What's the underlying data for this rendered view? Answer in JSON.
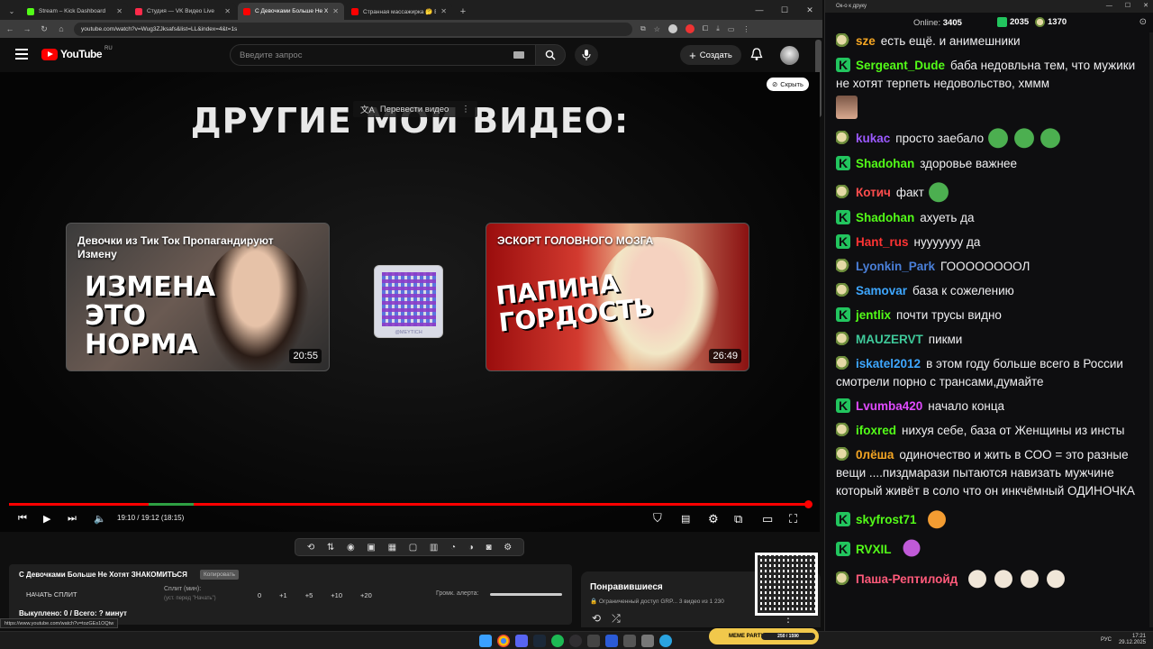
{
  "browser": {
    "tabs": [
      {
        "title": "Stream – Kick Dashboard",
        "fav": "#53fc18"
      },
      {
        "title": "Студия — VK Видео Live",
        "fav": "#ff2a4a"
      },
      {
        "title": "С Девочками Больше Не Хотя",
        "fav": "#ff0000",
        "active": true
      },
      {
        "title": "Странная массажирка 🤔 Вид",
        "fav": "#ff0000"
      }
    ],
    "url": "youtube.com/watch?v=Wug3ZJksafs&list=LL&index=4&t=1s",
    "status_url": "https://www.youtube.com/watch?v=tozGEs1OQtw"
  },
  "youtube": {
    "logo": "YouTube",
    "region": "RU",
    "search_placeholder": "Введите запрос",
    "create_label": "Создать"
  },
  "endscreen": {
    "heading": "ДРУГИЕ МОИ ВИДЕО:",
    "translate": "Перевести видео",
    "hide": "Скрыть",
    "cards": [
      {
        "title": "Девочки из Тик Ток Пропагандируют Измену",
        "thumb_text": "ИЗМЕНА ЭТО НОРМА",
        "duration": "20:55"
      },
      {
        "title": "ЭСКОРТ ГОЛОВНОГО МОЗГА",
        "thumb_text": "ПАПИНА ГОРДОСТЬ",
        "duration": "26:49"
      }
    ],
    "qr_label": "@MEYTICH"
  },
  "player": {
    "time": "19:10 / 19:12 (18:15)",
    "progress_fraction": 0.998
  },
  "panel": {
    "title": "С Девочками Больше Не Хотят ЗНАКОМИТЬСЯ",
    "badge": "Копировать",
    "start": "НАЧАТЬ СПЛИТ",
    "split_label": "Сплит (мин):",
    "split_hint": "(уст. перед \"Начать\")",
    "nums": [
      "0",
      "+1",
      "+5",
      "+10",
      "+20"
    ],
    "alert_label": "Громк. алерта:",
    "bought": "Выкуплено: 0 / Всего: ? минут"
  },
  "liked": {
    "title": "Понравившиеся",
    "sub": "🔒 Ограниченный доступ  GRP...  3 видео из 1 230"
  },
  "meme": {
    "label": "MEME PARTY",
    "progress": "250 / 1590"
  },
  "taskbar": {
    "lang": "РУС",
    "time": "17:21",
    "date": "29.12.2025"
  },
  "chat": {
    "window_title": "Ок-о к друку",
    "online_label": "Online:",
    "online": "3405",
    "kick_count": "2035",
    "rumble_count": "1370",
    "messages": [
      {
        "platform": "r",
        "nick": "sze",
        "color": "#f5a623",
        "text": "есть ещё. и анимешники"
      },
      {
        "platform": "k",
        "nick": "Sergeant_Dude",
        "color": "#53fc18",
        "text": "баба недовльна тем, что мужики не хотят терпеть недовольство, хммм"
      },
      {
        "platform": "r",
        "nick": "kukac",
        "color": "#9b59ff",
        "text": "просто заебало",
        "emotes": [
          "frog",
          "frog",
          "frog"
        ]
      },
      {
        "platform": "k",
        "nick": "Shadohan",
        "color": "#53fc18",
        "text": "здоровье важнее"
      },
      {
        "platform": "r",
        "nick": "Котич",
        "color": "#ff4d4d",
        "text": "факт",
        "emotes": [
          "frog"
        ]
      },
      {
        "platform": "k",
        "nick": "Shadohan",
        "color": "#53fc18",
        "text": "ахуеть да"
      },
      {
        "platform": "k",
        "nick": "Hant_rus",
        "color": "#ff3333",
        "text": "нууууууу да"
      },
      {
        "platform": "r",
        "nick": "Lyonkin_Park",
        "color": "#4a7fd8",
        "text": "ГООООООООЛ"
      },
      {
        "platform": "r",
        "nick": "Samovar",
        "color": "#3ea7ff",
        "text": "база к сожелению"
      },
      {
        "platform": "k",
        "nick": "jentlix",
        "color": "#53fc18",
        "text": "почти трусы видно"
      },
      {
        "platform": "r",
        "nick": "MAUZERVT",
        "color": "#3fc99a",
        "text": "пикми"
      },
      {
        "platform": "r",
        "nick": "iskatel2012",
        "color": "#3ea7ff",
        "text": "в этом году больше всего в России смотрели порно с трансами,думайте"
      },
      {
        "platform": "k",
        "nick": "Lvumba420",
        "color": "#e04bff",
        "text": "начало конца"
      },
      {
        "platform": "r",
        "nick": "ifoxred",
        "color": "#53fc18",
        "text": "нихуя себе, база от Женщины из инсты"
      },
      {
        "platform": "r",
        "nick": "0лёша",
        "color": "#f5a623",
        "text": "одиночество и жить в СОО = это разные вещи ....пиздмарази пытаются навизать мужчине который живёт в соло что он инкчёмный ОДИНОЧКА"
      },
      {
        "platform": "k",
        "nick": "skyfrost71",
        "color": "#53fc18",
        "text": "",
        "emotes": [
          "orange"
        ]
      },
      {
        "platform": "k",
        "nick": "RVXIL",
        "color": "#53fc18",
        "text": "",
        "emotes": [
          "purple"
        ]
      },
      {
        "platform": "r",
        "nick": "Паша-Рептилойд",
        "color": "#ff5a7a",
        "text": "",
        "emotes": [
          "cat",
          "cat",
          "cat",
          "cat"
        ]
      }
    ]
  }
}
